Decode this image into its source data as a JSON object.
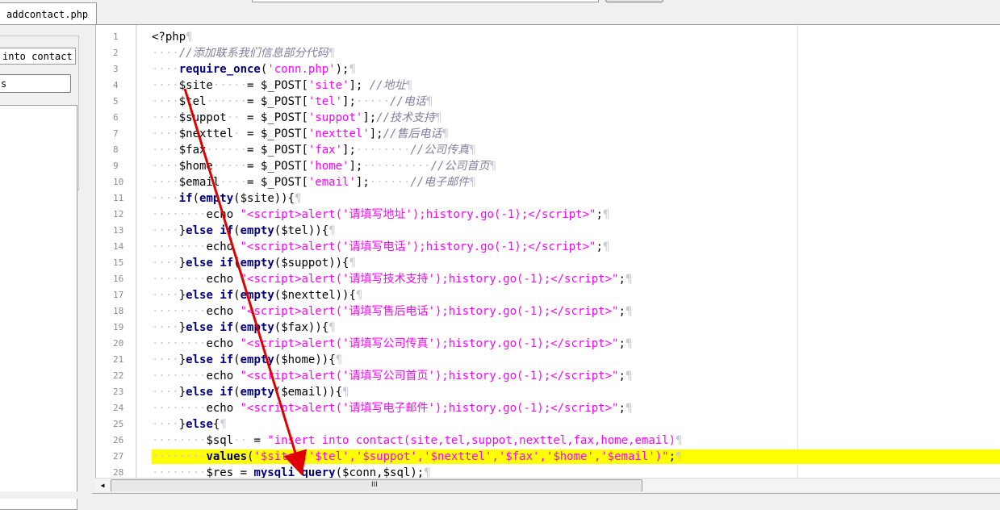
{
  "tab": {
    "label": "addcontact.php"
  },
  "left_panel": {
    "field_text": "into contact",
    "field2_text": "s"
  },
  "editor": {
    "line_numbers": [
      "1",
      "2",
      "3",
      "4",
      "5",
      "6",
      "7",
      "8",
      "9",
      "10",
      "11",
      "12",
      "13",
      "14",
      "15",
      "16",
      "17",
      "18",
      "19",
      "20",
      "21",
      "22",
      "23",
      "24",
      "25",
      "26",
      "27",
      "28"
    ],
    "highlighted_line": 27
  },
  "scrollbar": {
    "left_arrow": "◀",
    "grip": "III"
  },
  "colors": {
    "keyword": "#00007f",
    "string": "#ff00ff",
    "comment": "#7f7f9f",
    "highlight": "#ffff00",
    "arrow": "#e00000"
  }
}
